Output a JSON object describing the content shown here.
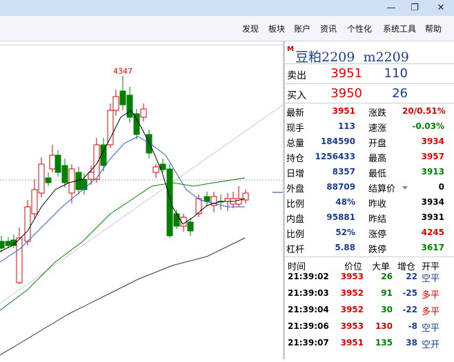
{
  "window": {
    "min": "—",
    "max": "❐",
    "close": "✕"
  },
  "menu": [
    "发现",
    "板块",
    "账户",
    "资讯",
    "个性化",
    "系统工具",
    "帮助"
  ],
  "chart_annotation": {
    "high_label": "4347"
  },
  "contract": {
    "marker": "M",
    "name": "豆粕2209",
    "code": "m2209"
  },
  "quote": {
    "sell_label": "卖出",
    "sell_price": "3951",
    "sell_vol": "110",
    "buy_label": "买入",
    "buy_price": "3950",
    "buy_vol": "26"
  },
  "stats": [
    {
      "l1": "最新",
      "v1": "3951",
      "c1": "red",
      "l2": "涨跌",
      "v2": "20/0.51%",
      "c2": "red"
    },
    {
      "l1": "现手",
      "v1": "113",
      "c1": "blue",
      "l2": "速涨",
      "v2": "-0.03%",
      "c2": "green"
    },
    {
      "l1": "总量",
      "v1": "184590",
      "c1": "blue",
      "l2": "开盘",
      "v2": "3934",
      "c2": "red"
    },
    {
      "l1": "持仓",
      "v1": "1256433",
      "c1": "blue",
      "l2": "最高",
      "v2": "3957",
      "c2": "red"
    },
    {
      "l1": "日增",
      "v1": "8357",
      "c1": "blue",
      "l2": "最低",
      "v2": "3913",
      "c2": "green"
    },
    {
      "l1": "外盘",
      "v1": "88709",
      "c1": "blue",
      "l2": "结算价",
      "v2": "0",
      "c2": "black"
    },
    {
      "l1": "比例",
      "v1": "48%",
      "c1": "blue",
      "l2": "昨收",
      "v2": "3934",
      "c2": "black"
    },
    {
      "l1": "内盘",
      "v1": "95881",
      "c1": "blue",
      "l2": "昨结",
      "v2": "3931",
      "c2": "black"
    },
    {
      "l1": "比例",
      "v1": "52%",
      "c1": "blue",
      "l2": "涨停",
      "v2": "4245",
      "c2": "red"
    },
    {
      "l1": "杠杆",
      "v1": "5.88",
      "c1": "blue",
      "l2": "跌停",
      "v2": "3617",
      "c2": "green"
    }
  ],
  "ticks_header": {
    "time": "时间",
    "price": "价位",
    "vol": "大单",
    "chg": "增仓",
    "type": "开平"
  },
  "ticks": [
    {
      "time": "21:39:02",
      "price": "3953",
      "pc": "red",
      "vol": "26",
      "vc": "green",
      "chg": "22",
      "type": "空平",
      "tc": "blue"
    },
    {
      "time": "21:39:03",
      "price": "3952",
      "pc": "red",
      "vol": "91",
      "vc": "green",
      "chg": "-25",
      "type": "多平",
      "tc": "red"
    },
    {
      "time": "21:39:04",
      "price": "3952",
      "pc": "red",
      "vol": "30",
      "vc": "green",
      "chg": "-22",
      "type": "多平",
      "tc": "red"
    },
    {
      "time": "21:39:06",
      "price": "3953",
      "pc": "red",
      "vol": "130",
      "vc": "red",
      "chg": "-8",
      "type": "空平",
      "tc": "blue"
    },
    {
      "time": "21:39:07",
      "price": "3951",
      "pc": "red",
      "vol": "135",
      "vc": "green",
      "chg": "38",
      "type": "空开",
      "tc": "blue"
    }
  ],
  "colors": {
    "up": "#e00000",
    "down": "#008000",
    "ma5": "#000000",
    "ma10": "#2a5bd7",
    "ma20": "#008000",
    "ma60": "#333333",
    "trend": "#bbbbbb"
  }
}
